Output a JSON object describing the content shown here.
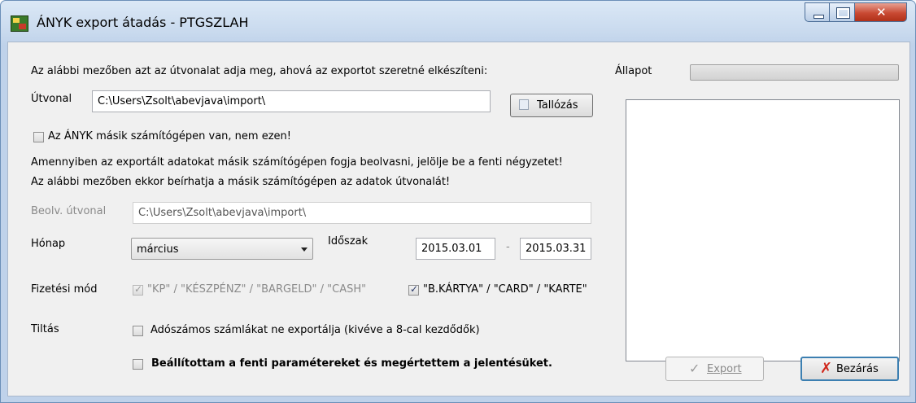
{
  "window": {
    "title": "ÁNYK export átadás - PTGSZLAH"
  },
  "form": {
    "intro": "Az alábbi mezőben azt az útvonalat adja meg, ahová az exportot szeretné elkészíteni:",
    "path_label": "Útvonal",
    "path_value": "C:\\Users\\Zsolt\\abevjava\\import\\",
    "browse_label": "Tallózás",
    "other_machine_label": "Az ÁNYK másik számítógépen van, nem ezen!",
    "info_line1": "Amennyiben az exportált adatokat másik számítógépen fogja beolvasni, jelölje be a fenti négyzetet!",
    "info_line2": "Az alábbi mezőben ekkor beírhatja a másik számítógépen az adatok útvonalát!",
    "read_path_label": "Beolv. útvonal",
    "read_path_value": "C:\\Users\\Zsolt\\abevjava\\import\\",
    "month_label": "Hónap",
    "month_value": "március",
    "period_label": "Időszak",
    "period_start": "2015.03.01",
    "period_separator": "-",
    "period_end": "2015.03.31",
    "payment_label": "Fizetési mód",
    "payment_cash": "\"KP\" / \"KÉSZPÉNZ\" / \"BARGELD\" / \"CASH\"",
    "payment_card": "\"B.KÁRTYA\" / \"CARD\" / \"KARTE\"",
    "ban_label": "Tiltás",
    "ban_option": "Adószámos számlákat ne exportálja (kivéve a 8-cal kezdődők)",
    "confirm_label": "Beállítottam a fenti paramétereket és megértettem a jelentésüket."
  },
  "status": {
    "label": "Állapot",
    "progress": 0
  },
  "buttons": {
    "export": "Export",
    "close": "Bezárás"
  },
  "state": {
    "other_machine_checked": false,
    "payment_cash_checked": true,
    "payment_card_checked": true,
    "ban_checked": false,
    "confirm_checked": false
  },
  "colors": {
    "close_icon": "#d0281c",
    "titlebar": "#c9daee",
    "export_disabled": "#8a8a8a"
  }
}
